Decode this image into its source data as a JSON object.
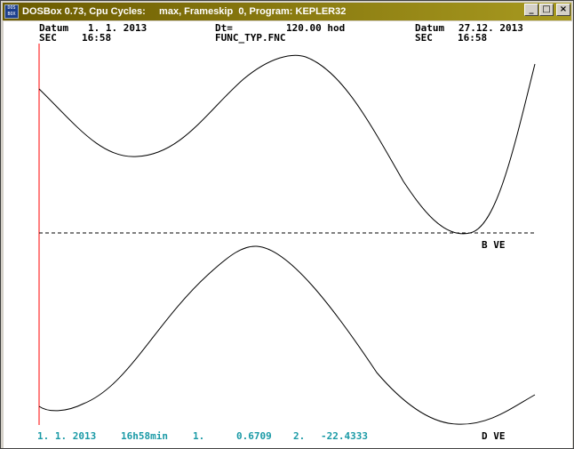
{
  "window": {
    "icon_text_top": "DOS",
    "icon_text_bottom": "BOX",
    "title": "DOSBox 0.73, Cpu Cycles:     max, Frameskip  0, Program: KEPLER32",
    "btn_minimize": "_",
    "btn_maximize": "□",
    "btn_close": "×"
  },
  "header": {
    "left_datum_label": "Datum",
    "left_datum_value": "1. 1. 2013",
    "left_sec_label": "SEC",
    "left_sec_value": "16:58",
    "dt_label": "Dt=",
    "dt_value": "120.00 hod",
    "file_name": "FUNC_TYP.FNC",
    "right_datum_label": "Datum",
    "right_datum_value": "27.12. 2013",
    "right_sec_label": "SEC",
    "right_sec_value": "16:58"
  },
  "plots": {
    "upper_label": "B VE",
    "lower_label": "D VE"
  },
  "status": {
    "date": "1. 1. 2013",
    "time": "16h58min",
    "v1_label": "1.",
    "v1_value": "0.6709",
    "v2_label": "2.",
    "v2_value": "-22.4333"
  },
  "colors": {
    "axis_red": "#ff0000",
    "status_cyan": "#1a9aa6",
    "title_bar_start": "#6a5a00",
    "title_bar_end": "#a89a20"
  }
}
